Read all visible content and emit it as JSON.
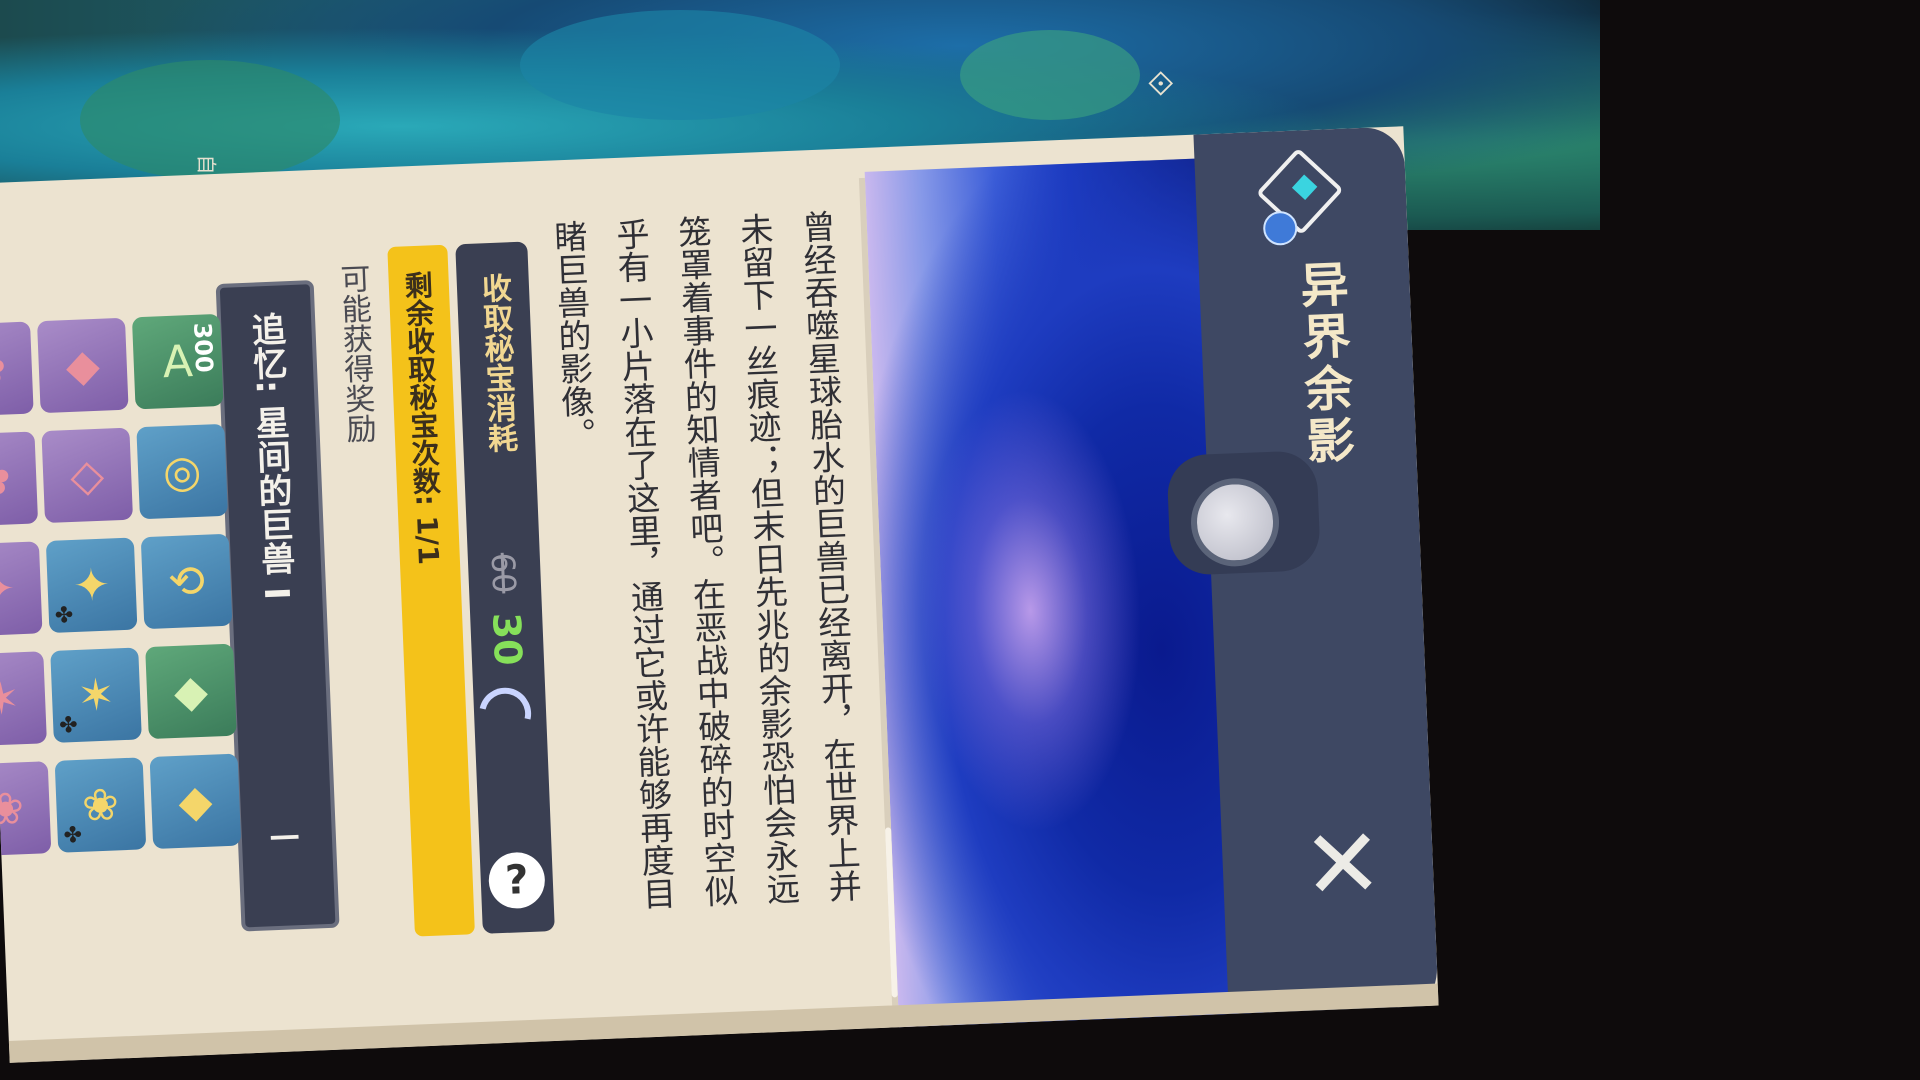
{
  "map": {
    "label": "自"
  },
  "panel": {
    "title": "异界余影",
    "description": "曾经吞噬星球胎水的巨兽已经离开，在世界上并未留下一丝痕迹；但末日先兆的余影恐怕会永远笼罩着事件的知情者吧。在恶战中破碎的时空似乎有一小片落在了这里，通过它或许能够再度目睹巨兽的影像。",
    "cost_label": "收取秘宝消耗",
    "cost_old": "60",
    "cost_new": "30",
    "help": "?",
    "remaining_label": "剩余收取秘宝次数: 1/1",
    "rewards_label": "可能获得奖励",
    "selector_label": "追忆: 星间的巨兽 I",
    "selector_marker": "I",
    "close_symbol": "✕",
    "rewards": [
      {
        "icon": "adventure-exp-icon",
        "glyph": "A",
        "qty": "300",
        "color": "green"
      },
      {
        "icon": "mora-coin-icon",
        "glyph": "◎",
        "qty": "",
        "color": "blue"
      },
      {
        "icon": "companionship-exp-icon",
        "glyph": "⟲",
        "qty": "",
        "color": "blue"
      },
      {
        "icon": "crystal-chunk-icon",
        "glyph": "◆",
        "qty": "",
        "color": "green"
      },
      {
        "icon": "lapis-gem-icon",
        "glyph": "◆",
        "qty": "",
        "color": "blue"
      },
      {
        "icon": "sapphire-gem-icon",
        "glyph": "◆",
        "qty": "",
        "color": "purple"
      },
      {
        "icon": "crystal-prism-icon",
        "glyph": "◇",
        "qty": "",
        "color": "purple"
      },
      {
        "icon": "red-feather-artifact-icon",
        "glyph": "✦",
        "qty": "",
        "color": "blue"
      },
      {
        "icon": "star-artifact-icon",
        "glyph": "✶",
        "qty": "",
        "color": "blue"
      },
      {
        "icon": "lotus-artifact-icon",
        "glyph": "❀",
        "qty": "",
        "color": "blue"
      },
      {
        "icon": "red-flower-artifact-icon",
        "glyph": "✿",
        "qty": "",
        "color": "purple"
      },
      {
        "icon": "blue-flower-artifact-icon",
        "glyph": "✿",
        "qty": "",
        "color": "purple"
      },
      {
        "icon": "rose-artifact-icon",
        "glyph": "✦",
        "qty": "",
        "color": "purple"
      },
      {
        "icon": "gold-star-artifact-icon",
        "glyph": "✶",
        "qty": "",
        "color": "purple"
      },
      {
        "icon": "green-lotus-artifact-icon",
        "glyph": "❀",
        "qty": "",
        "color": "purple"
      }
    ]
  },
  "colors": {
    "remaining_bar": "#f4c21a",
    "cost_new": "#86e05a",
    "header_rail": "#3e4863"
  }
}
